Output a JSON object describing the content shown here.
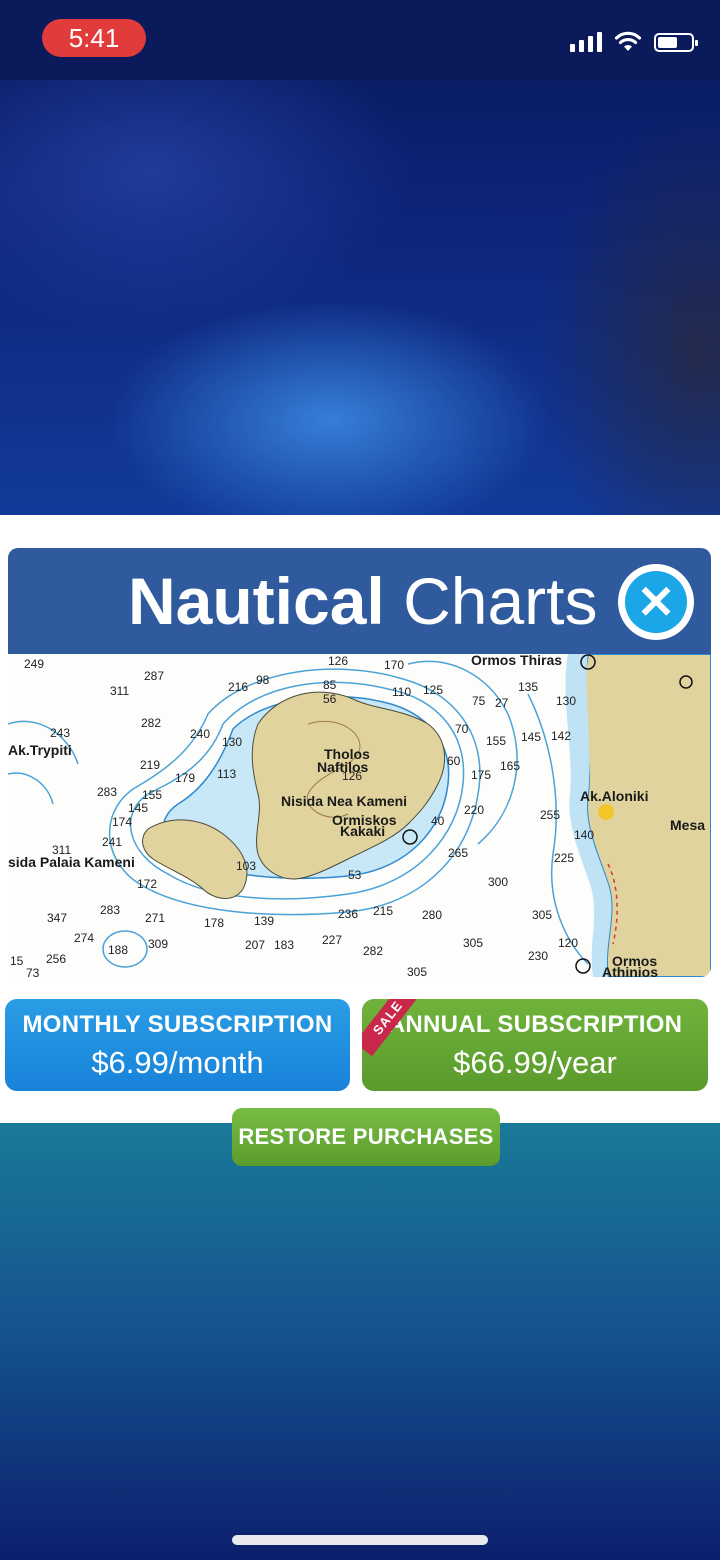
{
  "status_bar": {
    "time": "5:41"
  },
  "header": {
    "title_bold": "Nautical",
    "title_light": "Charts"
  },
  "map": {
    "places": [
      "Ormos Thiras",
      "Ak.Trypiti",
      "Tholos",
      "Naftilos",
      "Nisida Nea Kameni",
      "Ormiskos",
      "Kakaki",
      "Ak.Aloniki",
      "Mesa",
      "sida Palaia Kameni",
      "Ormos",
      "Athinios"
    ],
    "depths": [
      "249",
      "287",
      "311",
      "216",
      "126",
      "170",
      "110",
      "125",
      "135",
      "130",
      "243",
      "282",
      "240",
      "130",
      "145",
      "142",
      "219",
      "179",
      "113",
      "155",
      "165",
      "175",
      "283",
      "155",
      "145",
      "174",
      "220",
      "255",
      "140",
      "311",
      "241",
      "265",
      "225",
      "172",
      "300",
      "347",
      "283",
      "271",
      "178",
      "139",
      "236",
      "215",
      "280",
      "305",
      "274",
      "188",
      "309",
      "207",
      "183",
      "227",
      "282",
      "305",
      "120",
      "230",
      "256",
      "305",
      "73",
      "126",
      "103",
      "53",
      "15",
      "60",
      "70",
      "40",
      "75",
      "27",
      "56",
      "85",
      "98"
    ]
  },
  "subscriptions": {
    "monthly": {
      "title": "MONTHLY SUBSCRIPTION",
      "price": "$6.99/month"
    },
    "annual": {
      "ribbon": "SALE",
      "title": "ANNUAL SUBSCRIPTION",
      "price": "$66.99/year"
    }
  },
  "restore_label": "RESTORE PURCHASES",
  "colors": {
    "header": "#2f5a9e",
    "close": "#1ba6e8",
    "monthly": "#1f8fe0",
    "annual": "#64a834",
    "sale": "#c9284a",
    "land": "#e0d39e",
    "water": "#bfe3f5",
    "time_pill": "#e23b3b"
  }
}
